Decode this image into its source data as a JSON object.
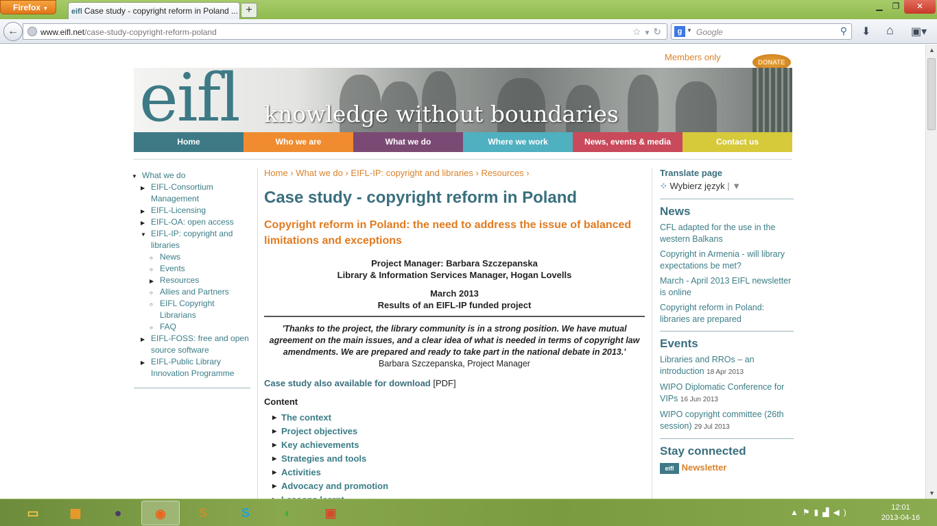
{
  "browser": {
    "app_button": "Firefox",
    "tab_title": "Case study - copyright reform in Poland ...",
    "tab_favicon_text": "eifl",
    "url_domain": "www.eifl.net",
    "url_path": "/case-study-copyright-reform-poland",
    "search_placeholder": "Google",
    "search_engine_letter": "g"
  },
  "header": {
    "members_link": "Members only",
    "donate_button": "DONATE",
    "logo_text": "eifl",
    "tagline": "knowledge without boundaries"
  },
  "main_nav": [
    {
      "label": "Home",
      "color": "#3e7a86"
    },
    {
      "label": "Who we are",
      "color": "#f08c2f"
    },
    {
      "label": "What we do",
      "color": "#7b4a74"
    },
    {
      "label": "Where we work",
      "color": "#4fb0c0"
    },
    {
      "label": "News, events & media",
      "color": "#c84a5b"
    },
    {
      "label": "Contact us",
      "color": "#d6c93a"
    }
  ],
  "left_nav": {
    "root": "What we do",
    "items": [
      {
        "label": "EIFL-Consortium Management",
        "level": 1,
        "marker": "collapsed"
      },
      {
        "label": "EIFL-Licensing",
        "level": 1,
        "marker": "collapsed"
      },
      {
        "label": "EIFL-OA: open access",
        "level": 1,
        "marker": "collapsed"
      },
      {
        "label": "EIFL-IP: copyright and libraries",
        "level": 1,
        "marker": "expanded"
      },
      {
        "label": "News",
        "level": 2,
        "marker": "leaf"
      },
      {
        "label": "Events",
        "level": 2,
        "marker": "leaf"
      },
      {
        "label": "Resources",
        "level": 2,
        "marker": "collapsed"
      },
      {
        "label": "Allies and Partners",
        "level": 2,
        "marker": "leaf"
      },
      {
        "label": "EIFL Copyright Librarians",
        "level": 2,
        "marker": "leaf"
      },
      {
        "label": "FAQ",
        "level": 2,
        "marker": "leaf"
      },
      {
        "label": "EIFL-FOSS: free and open source software",
        "level": 1,
        "marker": "collapsed"
      },
      {
        "label": "EIFL-Public Library Innovation Programme",
        "level": 1,
        "marker": "collapsed"
      }
    ]
  },
  "content": {
    "breadcrumb": "Home › What we do › EIFL-IP: copyright and libraries › Resources ›",
    "title": "Case study - copyright reform in Poland",
    "subtitle": "Copyright reform in Poland: the need to address the issue of balanced limitations and exceptions",
    "project_manager": "Project Manager: Barbara Szczepanska",
    "pm_role": "Library & Information Services Manager, Hogan Lovells",
    "date": "March 2013",
    "results": "Results of an EIFL-IP funded project",
    "quote": "'Thanks to the project, the library community is in a strong position. We have mutual agreement on the main issues, and a clear idea of what is needed in terms of copyright law amendments. We are prepared and ready to take part in the national debate in 2013.'",
    "quote_author": "Barbara Szczepanska, Project Manager",
    "download_link": "Case study also available for download",
    "download_format": "[PDF]",
    "contents_heading": "Content",
    "toc": [
      "The context",
      "Project objectives",
      "Key achievements",
      "Strategies and tools",
      "Activities",
      "Advocacy and promotion",
      "Lessons learnt"
    ]
  },
  "right_sidebar": {
    "translate_heading": "Translate page",
    "translate_select": "Wybierz język",
    "news_heading": "News",
    "news": [
      "CFL adapted for the use in the western Balkans",
      "Copyright in Armenia - will library expectations be met?",
      "March - April 2013 EIFL newsletter is online",
      "Copyright reform in Poland: libraries are prepared"
    ],
    "events_heading": "Events",
    "events": [
      {
        "title": "Libraries and RROs – an introduction",
        "date": "18 Apr 2013"
      },
      {
        "title": "WIPO Diplomatic Conference for VIPs",
        "date": "16 Jun 2013"
      },
      {
        "title": "WIPO copyright committee (26th session)",
        "date": "29 Jul 2013"
      }
    ],
    "stay_heading": "Stay connected",
    "newsletter": "Newsletter"
  },
  "taskbar": {
    "time": "12:01",
    "date": "2013-04-16",
    "apps": [
      {
        "name": "file-explorer-icon",
        "glyph": "▭",
        "color": "#f3c34a"
      },
      {
        "name": "grid-app-icon",
        "glyph": "▦",
        "color": "#f39a2a"
      },
      {
        "name": "media-app-icon",
        "glyph": "●",
        "color": "#4a3a6a"
      },
      {
        "name": "firefox-icon",
        "glyph": "◉",
        "color": "#e8661f"
      },
      {
        "name": "s-app-icon",
        "glyph": "S",
        "color": "#c8902e"
      },
      {
        "name": "skype-icon",
        "glyph": "S",
        "color": "#1aa2e0"
      },
      {
        "name": "green-app-icon",
        "glyph": "◐",
        "color": "#3fae3a"
      },
      {
        "name": "presentation-app-icon",
        "glyph": "▣",
        "color": "#d44a2a"
      }
    ]
  }
}
